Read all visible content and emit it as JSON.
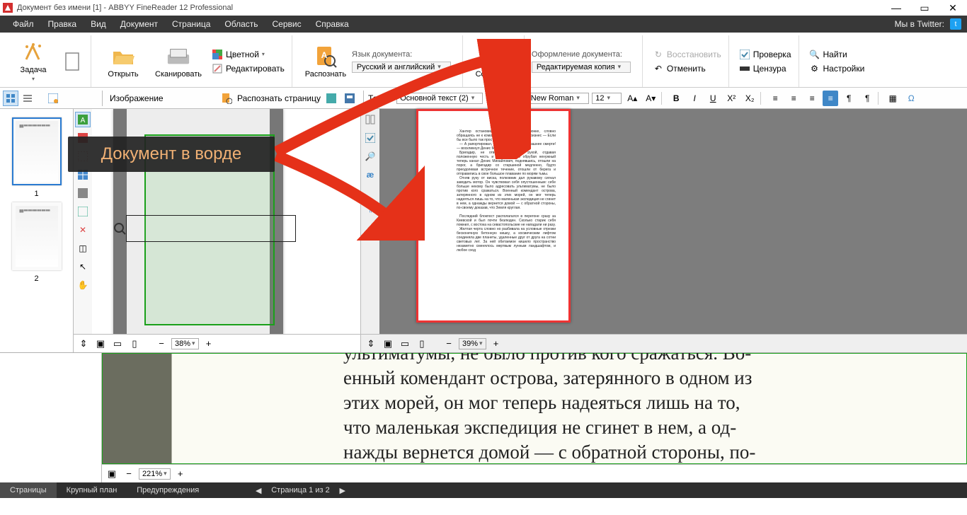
{
  "title": "Документ без имени [1] - ABBYY FineReader 12 Professional",
  "menu": {
    "file": "Файл",
    "edit": "Правка",
    "view": "Вид",
    "document": "Документ",
    "page": "Страница",
    "area": "Область",
    "service": "Сервис",
    "help": "Справка",
    "twitter": "Мы в Twitter:"
  },
  "ribbon": {
    "task": "Задача",
    "open": "Открыть",
    "scan": "Сканировать",
    "color": "Цветной",
    "edit": "Редактировать",
    "recognize": "Распознать",
    "lang_label": "Язык документа:",
    "lang_value": "Русский и английский",
    "save": "Сохранить",
    "layout_label": "Оформление документа:",
    "layout_value": "Редактируемая копия",
    "restore": "Восстановить",
    "undo": "Отменить",
    "verify": "Проверка",
    "censor": "Цензура",
    "find": "Найти",
    "settings": "Настройки"
  },
  "modebar": {
    "image_label": "Изображение",
    "recognize_page": "Распознать страницу",
    "text_label": "Текст",
    "style": "Основной текст (2)",
    "font": "Times New Roman",
    "size": "12"
  },
  "thumbs": {
    "p1": "1",
    "p2": "2"
  },
  "zoom": {
    "image": "38%",
    "text": "39%",
    "big": "221%"
  },
  "annotation": "Документ в ворде",
  "doc_preview": {
    "para1": "Хантер остановился на миг в сторонке, словно обращаясь не к командиру, а сам к себе, произнес — Если бы все было так просто.",
    "para2": "— А рапортировал, на Судоме — еще страшнее смерти! — воскликнул Денис Михайлович.",
    "para3": "Бригадир, не отвечая, взмахнул рукой, отдавая положенную честь и одновременно обрубая ненужный теперь канал Денис Михайлович, поднявшись, отошли на порог, а бригадир со старшиной медленно, будто преодолевая встречное течение, отошли от берега и отправились в свое большое плавание по морям тьмы.",
    "para4": "Отняв руку от виска, полковник дал рукавому сигнал заводить мотор. Он чувствовал себя опустошенным: себе больше некому было адресовать ультиматумы, не было против кого сражаться. Военный комендант острова, затерянного в одном из этих морей, он мог теперь надеяться лишь на то, что маленькая экспедиция не сгинет в нем, а однажды вернется домой — с обратной стороны, по-своему доказав, что Земля круглая.",
    "para5": "Последний блокпост располагался в перегоне сразу за Киевской и был почти безлюден. Сколько старик себя помнил, с востока на севастопольские не нападали ни разу.",
    "para6": "Желтая черта словно но разбивала на условные отрезки бесконечную бетонную кишку, а космическим лифтом соединяла две планеты, удаленные друг от друга на сотни световых лет. За ней обитаемое кишело пространство незаметно сменялось мертвым лунным ландшафтом, и любое сход"
  },
  "big_text": "ультиматумы, не было против кого сражаться. Во-\nенный комендант острова, затерянного в одном из\nэтих морей, он мог теперь надеяться лишь на то,\nчто маленькая экспедиция не сгинет в нем, а од-\nнажды вернется домой — с обратной стороны, по-",
  "status": {
    "pages": "Страницы",
    "zoom": "Крупный план",
    "warnings": "Предупреждения",
    "page_of": "Страница 1 из 2"
  }
}
